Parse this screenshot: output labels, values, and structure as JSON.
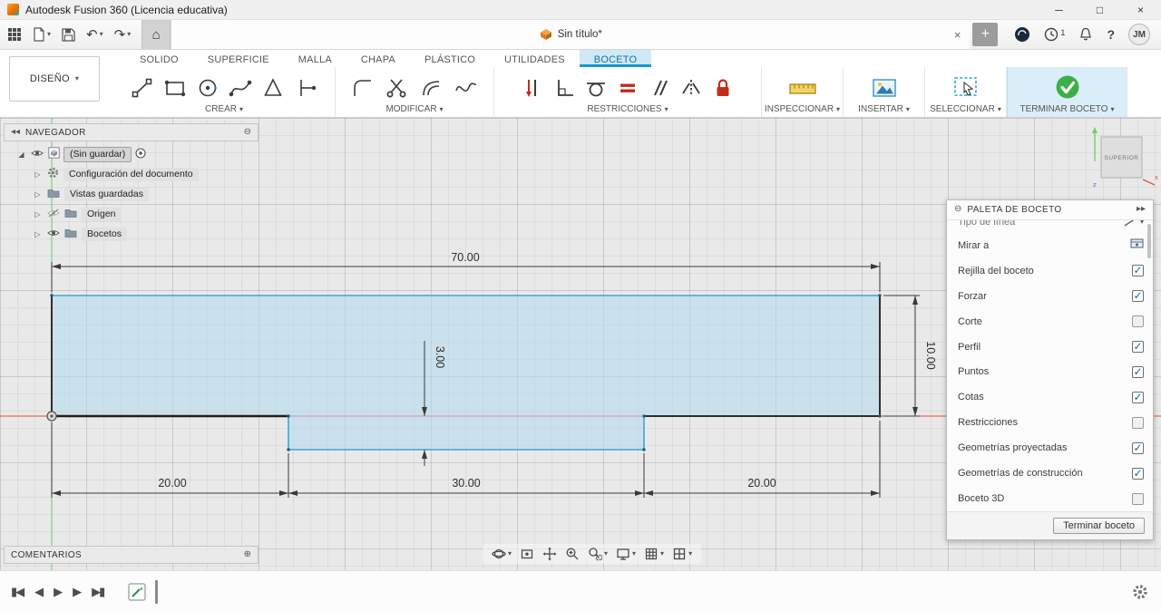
{
  "titlebar": {
    "title": "Autodesk Fusion 360 (Licencia educativa)"
  },
  "icons": {
    "minimize": "─",
    "maximize": "□",
    "close": "×",
    "caret": "▾",
    "plus": "+",
    "collapse": "⊖",
    "expand": "⊕",
    "chevrons_right": "▸▸",
    "chevrons_left": "◂◂",
    "home": "⌂",
    "undo": "↶",
    "redo": "↷",
    "skip_start": "▮◀",
    "step_back": "◀",
    "play": "▶",
    "step_forward": "▶",
    "skip_end": "▶▮",
    "root_expand": "◢",
    "branch_collapsed": "▷"
  },
  "quickbar": {
    "document_tab": "Sin título*",
    "new_tab": "+",
    "job_count": "1",
    "help": "?",
    "avatar": "JM"
  },
  "ribbon": {
    "design_label": "DISEÑO",
    "tabs": [
      {
        "label": "SOLIDO"
      },
      {
        "label": "SUPERFICIE"
      },
      {
        "label": "MALLA"
      },
      {
        "label": "CHAPA"
      },
      {
        "label": "PLÁSTICO"
      },
      {
        "label": "UTILIDADES"
      },
      {
        "label": "BOCETO"
      }
    ],
    "active_tab": "BOCETO",
    "groups": {
      "crear": "CREAR",
      "modificar": "MODIFICAR",
      "restricciones": "RESTRICCIONES",
      "inspeccionar": "INSPECCIONAR",
      "insertar": "INSERTAR",
      "seleccionar": "SELECCIONAR",
      "terminar": "TERMINAR BOCETO"
    }
  },
  "navigator": {
    "title": "NAVEGADOR",
    "root_label": "(Sin guardar)",
    "items": [
      {
        "label": "Configuración del documento"
      },
      {
        "label": "Vistas guardadas"
      },
      {
        "label": "Origen"
      },
      {
        "label": "Bocetos"
      }
    ]
  },
  "viewcube": {
    "face": "SUPERIOR",
    "axis_x": "x",
    "axis_z": "z"
  },
  "sketch": {
    "dimensions": {
      "total_width": "70.00",
      "right_height": "10.00",
      "step_depth": "3.00",
      "left_segment": "20.00",
      "middle_segment": "30.00",
      "right_segment": "20.00"
    }
  },
  "sketch_palette": {
    "title": "PALETA DE BOCETO",
    "options": [
      {
        "label": "Tipo de línea",
        "type": "partial"
      },
      {
        "label": "Mirar a",
        "type": "icon"
      },
      {
        "label": "Rejilla del boceto",
        "type": "checkbox",
        "checked": true
      },
      {
        "label": "Forzar",
        "type": "checkbox",
        "checked": true
      },
      {
        "label": "Corte",
        "type": "checkbox",
        "checked": false
      },
      {
        "label": "Perfil",
        "type": "checkbox",
        "checked": true
      },
      {
        "label": "Puntos",
        "type": "checkbox",
        "checked": true
      },
      {
        "label": "Cotas",
        "type": "checkbox",
        "checked": true
      },
      {
        "label": "Restricciones",
        "type": "checkbox",
        "checked": false
      },
      {
        "label": "Geometrías proyectadas",
        "type": "checkbox",
        "checked": true
      },
      {
        "label": "Geometrías de construcción",
        "type": "checkbox",
        "checked": true
      },
      {
        "label": "Boceto 3D",
        "type": "checkbox",
        "checked": false
      }
    ],
    "finish_button": "Terminar boceto"
  },
  "comments": {
    "title": "COMENTARIOS"
  },
  "colors": {
    "accent_blue": "#0696d7",
    "active_tab_bg": "#cfe9f6",
    "sketch_fill": "rgba(176,216,238,0.55)",
    "sketch_line_blue": "#3ba7d9",
    "sketch_line_dark": "#2e2e2e",
    "axis_x_red": "#e04f3a",
    "axis_y_green": "#6fcf6f",
    "finish_green": "#3fae49",
    "constraint_red": "#c42b1c"
  }
}
